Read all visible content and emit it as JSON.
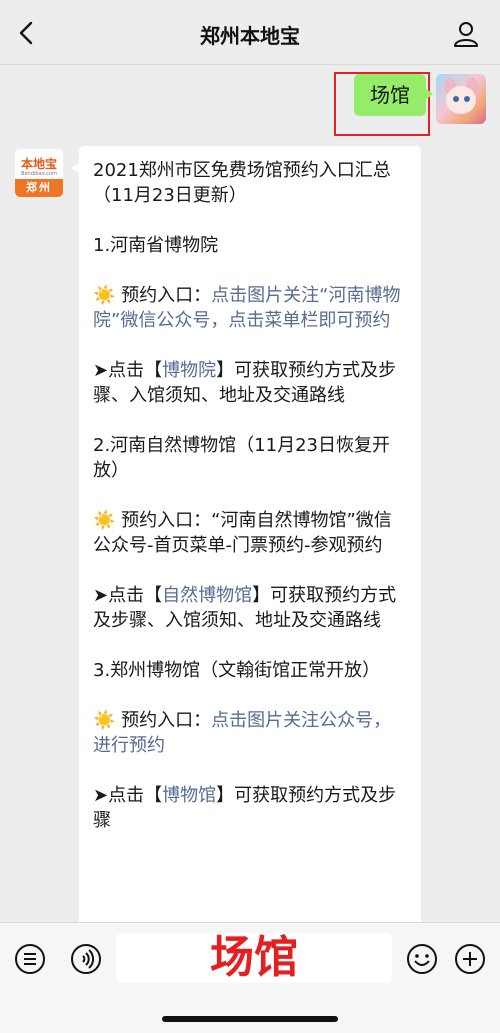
{
  "header": {
    "title": "郑州本地宝"
  },
  "chat": {
    "outgoing": {
      "text": "场馆"
    },
    "bot": {
      "avatar_top": "本地宝",
      "avatar_url": "Bendibao.com",
      "avatar_city": "郑州"
    },
    "message": {
      "title": "2021郑州市区免费场馆预约入口汇总（11月23日更新）",
      "sections": [
        {
          "heading": "1.河南省博物院",
          "booking_prefix": "☀️ 预约入口：",
          "booking_link": "点击图片关注“河南博物院”微信公众号，点击菜单栏即可预约",
          "booking_suffix": "",
          "detail_prefix": "➤点击【",
          "detail_link": "博物院",
          "detail_suffix": "】可获取预约方式及步骤、入馆须知、地址及交通路线"
        },
        {
          "heading": "2.河南自然博物馆（11月23日恢复开放）",
          "booking_prefix": "☀️ 预约入口：“河南自然博物馆”微信公众号-首页菜单-门票预约-参观预约",
          "booking_link": "",
          "booking_suffix": "",
          "detail_prefix": "➤点击【",
          "detail_link": "自然博物馆",
          "detail_suffix": "】可获取预约方式及步骤、入馆须知、地址及交通路线"
        },
        {
          "heading": "3.郑州博物馆（文翰街馆正常开放）",
          "booking_prefix": "☀️ 预约入口：",
          "booking_link": "点击图片关注公众号，进行预约",
          "booking_suffix": "",
          "detail_prefix": "➤点击【",
          "detail_link": "博物馆",
          "detail_suffix": "】可获取预约方式及步骤"
        }
      ]
    }
  },
  "input": {
    "text": "场馆"
  }
}
